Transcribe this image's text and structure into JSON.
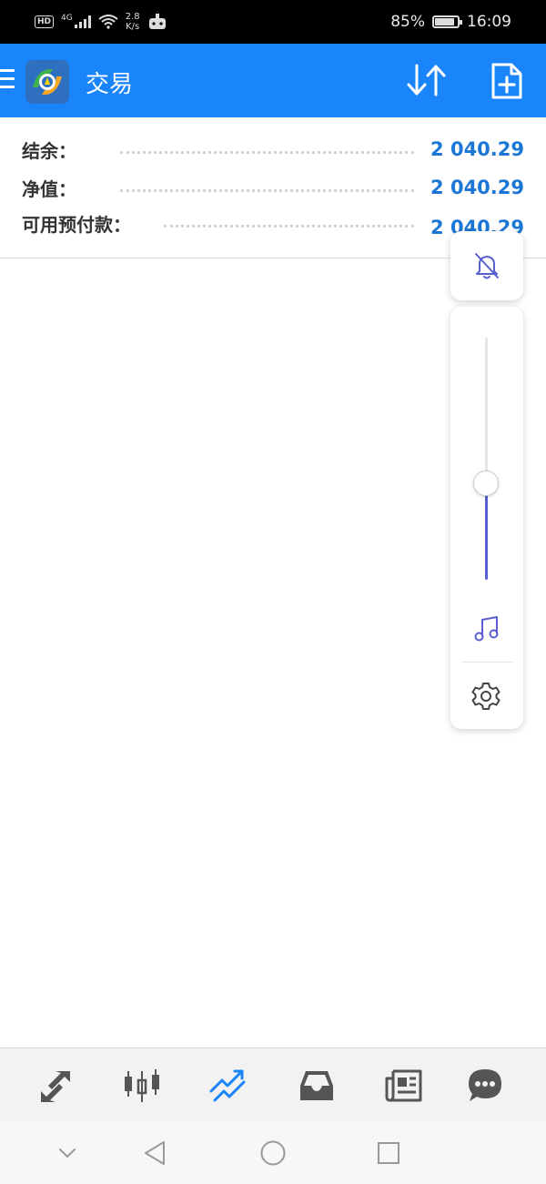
{
  "status_bar": {
    "hd": "HD",
    "network": "4G",
    "speed_value": "2.8",
    "speed_unit": "K/s",
    "battery": "85%",
    "time": "16:09"
  },
  "app_bar": {
    "title": "交易",
    "logo_icon": "metatrader-app-icon",
    "accent_color": "#1a84fb"
  },
  "summary": [
    {
      "label": "结余：",
      "value": "2 040.29"
    },
    {
      "label": "净值：",
      "value": "2 040.29"
    },
    {
      "label": "可用预付款：",
      "value": "2 040.29"
    }
  ],
  "volume_panel": {
    "level": 0.4,
    "accent_color": "#5a5fd0"
  },
  "tab_bar": {
    "tabs": [
      {
        "id": "quotes",
        "icon": "arrows-diagonal-icon",
        "active": false
      },
      {
        "id": "chart",
        "icon": "candlestick-icon",
        "active": false
      },
      {
        "id": "trade",
        "icon": "trend-lines-icon",
        "active": true
      },
      {
        "id": "history",
        "icon": "inbox-tray-icon",
        "active": false
      },
      {
        "id": "news",
        "icon": "newspaper-icon",
        "active": false
      },
      {
        "id": "chat",
        "icon": "chat-bubble-icon",
        "active": false
      }
    ],
    "active_color": "#1a84fb",
    "inactive_color": "#555555"
  }
}
